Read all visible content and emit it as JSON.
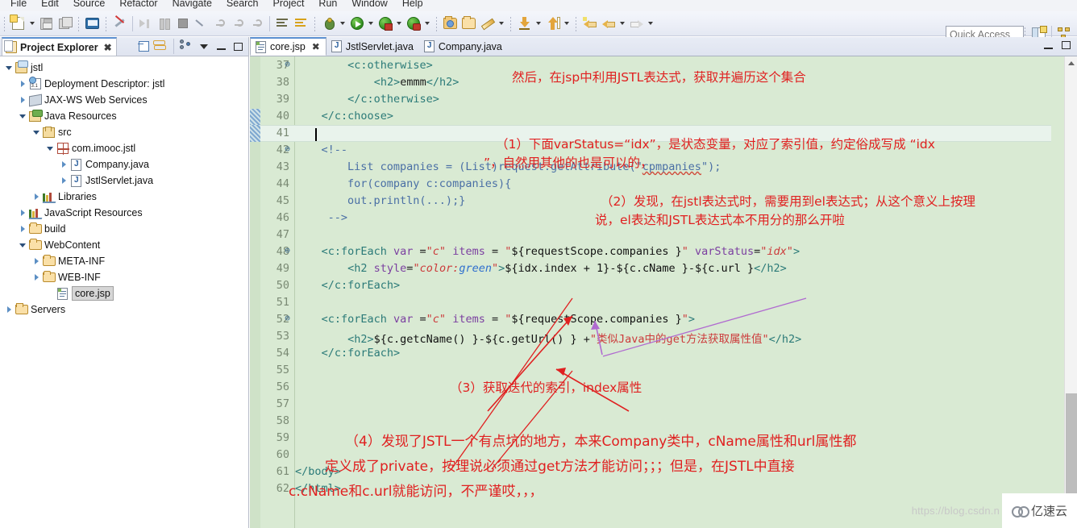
{
  "menu": {
    "items": [
      "File",
      "Edit",
      "Source",
      "Refactor",
      "Navigate",
      "Search",
      "Project",
      "Run",
      "Window",
      "Help"
    ]
  },
  "toolbar": {
    "quick_access_placeholder": "Quick Access",
    "quick_access_value": "",
    "buttons": [
      {
        "name": "new-wizard-icon",
        "title": "New"
      },
      {
        "name": "save-icon",
        "title": "Save"
      },
      {
        "name": "save-all-icon",
        "title": "Save All"
      },
      {
        "name": "console-icon",
        "title": "Open Console"
      },
      {
        "name": "skip-breakpoints-icon",
        "title": "Skip All Breakpoints"
      },
      {
        "name": "resume-icon",
        "title": "Resume"
      },
      {
        "name": "suspend-icon",
        "title": "Suspend"
      },
      {
        "name": "terminate-icon",
        "title": "Terminate"
      },
      {
        "name": "disconnect-icon",
        "title": "Disconnect"
      },
      {
        "name": "step-into-icon",
        "title": "Step Into"
      },
      {
        "name": "step-over-icon",
        "title": "Step Over"
      },
      {
        "name": "step-return-icon",
        "title": "Step Return"
      },
      {
        "name": "format-icon",
        "title": "Format"
      },
      {
        "name": "format-yellow-icon",
        "title": "Organize"
      },
      {
        "name": "debug-bug-icon",
        "title": "Debug"
      },
      {
        "name": "run-icon",
        "title": "Run"
      },
      {
        "name": "run-config-icon",
        "title": "Run Configuration"
      },
      {
        "name": "run-server-icon",
        "title": "Run on Server"
      },
      {
        "name": "open-folder-icon",
        "title": "Open Type"
      },
      {
        "name": "folder-icon",
        "title": "Open Resource"
      },
      {
        "name": "wand-icon",
        "title": "Quick Fix"
      },
      {
        "name": "export-icon",
        "title": "Export"
      },
      {
        "name": "import-icon",
        "title": "Import"
      },
      {
        "name": "back-star-icon",
        "title": "Back"
      },
      {
        "name": "back-icon",
        "title": "Previous Edit"
      },
      {
        "name": "forward-icon",
        "title": "Forward"
      }
    ]
  },
  "project_explorer": {
    "tab_label": "Project Explorer",
    "tree": [
      {
        "label": "jstl",
        "indent": 0,
        "arrow": "down",
        "icon": "project-icon",
        "selected": false
      },
      {
        "label": "Deployment Descriptor: jstl",
        "indent": 1,
        "arrow": "right",
        "icon": "deployment-descriptor-icon",
        "selected": false
      },
      {
        "label": "JAX-WS Web Services",
        "indent": 1,
        "arrow": "right",
        "icon": "web-services-icon",
        "selected": false
      },
      {
        "label": "Java Resources",
        "indent": 1,
        "arrow": "down",
        "icon": "java-resources-icon",
        "selected": false
      },
      {
        "label": "src",
        "indent": 2,
        "arrow": "down",
        "icon": "source-folder-icon",
        "selected": false
      },
      {
        "label": "com.imooc.jstl",
        "indent": 3,
        "arrow": "down",
        "icon": "package-icon",
        "selected": false
      },
      {
        "label": "Company.java",
        "indent": 4,
        "arrow": "right",
        "icon": "java-file-icon",
        "selected": false
      },
      {
        "label": "JstlServlet.java",
        "indent": 4,
        "arrow": "right",
        "icon": "java-file-icon",
        "selected": false
      },
      {
        "label": "Libraries",
        "indent": 2,
        "arrow": "right",
        "icon": "libraries-icon",
        "selected": false
      },
      {
        "label": "JavaScript Resources",
        "indent": 1,
        "arrow": "right",
        "icon": "libraries-icon",
        "selected": false
      },
      {
        "label": "build",
        "indent": 1,
        "arrow": "right",
        "icon": "folder-icon",
        "selected": false
      },
      {
        "label": "WebContent",
        "indent": 1,
        "arrow": "down",
        "icon": "folder-icon",
        "selected": false
      },
      {
        "label": "META-INF",
        "indent": 2,
        "arrow": "right",
        "icon": "folder-icon",
        "selected": false
      },
      {
        "label": "WEB-INF",
        "indent": 2,
        "arrow": "right",
        "icon": "folder-icon",
        "selected": false
      },
      {
        "label": "core.jsp",
        "indent": 3,
        "arrow": "none",
        "icon": "jsp-file-icon",
        "selected": true
      },
      {
        "label": "Servers",
        "indent": 0,
        "arrow": "right",
        "icon": "servers-folder-icon",
        "selected": false
      }
    ]
  },
  "editor": {
    "tabs": [
      {
        "label": "core.jsp",
        "icon": "jsp-file-icon",
        "active": true,
        "closeable": true
      },
      {
        "label": "JstlServlet.java",
        "icon": "java-file-icon",
        "active": false,
        "closeable": false
      },
      {
        "label": "Company.java",
        "icon": "java-file-icon",
        "active": false,
        "closeable": false
      }
    ],
    "background_color": "#d9ead3",
    "current_line": 41,
    "lines": [
      {
        "n": 37,
        "fold": true,
        "text": "        <c:otherwise>"
      },
      {
        "n": 38,
        "fold": false,
        "text": "            <h2>emmm</h2>"
      },
      {
        "n": 39,
        "fold": false,
        "text": "        </c:otherwise>"
      },
      {
        "n": 40,
        "fold": false,
        "text": "    </c:choose>"
      },
      {
        "n": 41,
        "fold": false,
        "text": ""
      },
      {
        "n": 42,
        "fold": true,
        "text": "    <!--"
      },
      {
        "n": 43,
        "fold": false,
        "text": "        List companies = (List)request.getAttribute(\"cpmpanies\");"
      },
      {
        "n": 44,
        "fold": false,
        "text": "        for(company c:companies){"
      },
      {
        "n": 45,
        "fold": false,
        "text": "        out.println(...);}"
      },
      {
        "n": 46,
        "fold": false,
        "text": "     -->"
      },
      {
        "n": 47,
        "fold": false,
        "text": ""
      },
      {
        "n": 48,
        "fold": true,
        "text": "    <c:forEach var =\"c\" items = \"${requestScope.companies }\" varStatus=\"idx\">"
      },
      {
        "n": 49,
        "fold": false,
        "text": "        <h2 style=\"color:green\">${idx.index + 1}-${c.cName }-${c.url }</h2>"
      },
      {
        "n": 50,
        "fold": false,
        "text": "    </c:forEach>"
      },
      {
        "n": 51,
        "fold": false,
        "text": ""
      },
      {
        "n": 52,
        "fold": true,
        "text": "    <c:forEach var =\"c\" items = \"${requestScope.companies }\">"
      },
      {
        "n": 53,
        "fold": false,
        "text": "        <h2>${c.getcName() }-${c.getUrl() } +\"类似Java中的get方法获取属性值\"</h2>"
      },
      {
        "n": 54,
        "fold": false,
        "text": "    </c:forEach>"
      },
      {
        "n": 55,
        "fold": false,
        "text": ""
      },
      {
        "n": 56,
        "fold": false,
        "text": ""
      },
      {
        "n": 57,
        "fold": false,
        "text": ""
      },
      {
        "n": 58,
        "fold": false,
        "text": ""
      },
      {
        "n": 59,
        "fold": false,
        "text": ""
      },
      {
        "n": 60,
        "fold": false,
        "text": ""
      },
      {
        "n": 61,
        "fold": false,
        "text": "</body>"
      },
      {
        "n": 62,
        "fold": false,
        "text": "</html>"
      }
    ],
    "annotations": [
      {
        "id": "note0",
        "text": "然后，在jsp中利用JSTL表达式，获取并遍历这个集合"
      },
      {
        "id": "note1_a",
        "text": "（1）下面varStatus=“idx”，是状态变量，对应了索引值，约定俗成写成 “idx"
      },
      {
        "id": "note1_b",
        "text": "”，自然用其他的也是可以的，"
      },
      {
        "id": "note2_a",
        "text": "（2）发现，在jstl表达式时，需要用到el表达式；从这个意义上按理"
      },
      {
        "id": "note2_b",
        "text": "说，el表达和JSTL表达式本不用分的那么开啦"
      },
      {
        "id": "note3",
        "text": "（3）获取迭代的索引，index属性"
      },
      {
        "id": "note4_a",
        "text": "（4）发现了JSTL一个有点坑的地方，本来Company类中，cName属性和url属性都"
      },
      {
        "id": "note4_b",
        "text": "定义成了private，按理说必须通过get方法才能访问；；；但是，在JSTL中直接"
      },
      {
        "id": "note4_c",
        "text": "c.cName和c.url就能访问，不严谨哎，，，"
      }
    ]
  },
  "watermark": {
    "url_text": "https://blog.csdn.n",
    "brand_text": "亿速云"
  },
  "colors": {
    "editor_background": "#d9ead3",
    "annotation_red": "#e02020",
    "tag_teal": "#2b7a78",
    "attribute_purple": "#7b3fa0",
    "string_red": "#cc3b3b",
    "comment_blue": "#4a6fa5",
    "tab_accent": "#5a8fd0"
  }
}
